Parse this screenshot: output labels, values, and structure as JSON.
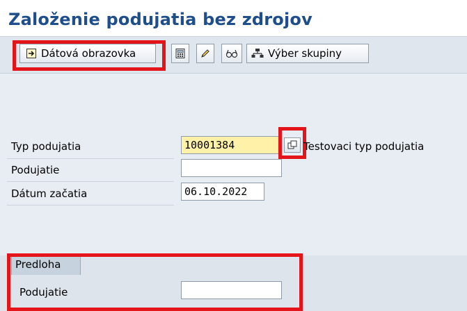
{
  "window": {
    "title": "Založenie podujatia bez zdrojov"
  },
  "toolbar": {
    "data_screen_label": "Dátová obrazovka",
    "group_select_label": "Výber skupiny",
    "icons": [
      "document-arrow-icon",
      "calculator-icon",
      "pencil-icon",
      "glasses-icon",
      "hierarchy-icon"
    ]
  },
  "form": {
    "event_type": {
      "label": "Typ podujatia",
      "value": "10001384",
      "description": "Testovaci typ podujatia"
    },
    "event": {
      "label": "Podujatie",
      "value": ""
    },
    "start_date": {
      "label": "Dátum začatia",
      "value": "06.10.2022"
    }
  },
  "template": {
    "tab_label": "Predloha",
    "event": {
      "label": "Podujatie",
      "value": ""
    }
  },
  "colors": {
    "highlight": "#e3141a",
    "title": "#1f4e8c",
    "required_field": "#fff1a8"
  }
}
